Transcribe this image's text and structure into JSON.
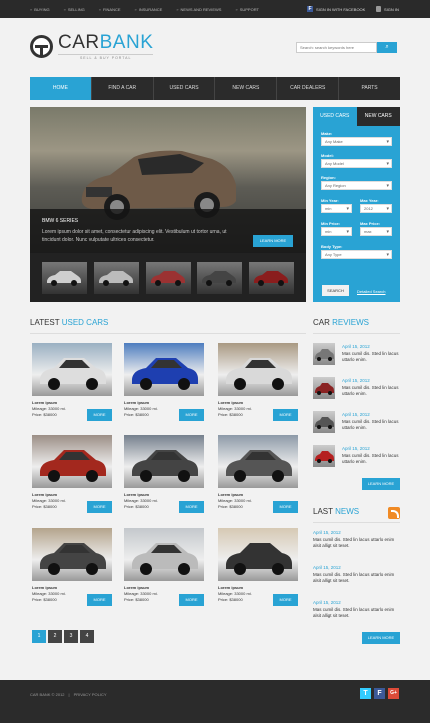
{
  "topbar": {
    "links": [
      "Buying",
      "Selling",
      "Finance",
      "Insurance",
      "News and reviews",
      "Support"
    ],
    "facebook": "Sign in with Facebook",
    "signin": "Sign in"
  },
  "logo": {
    "title_a": "CAR",
    "title_b": "BANK",
    "subtitle": "Sell & buy portal"
  },
  "search": {
    "placeholder": "Search: search keywords here"
  },
  "nav": [
    "Home",
    "Find a car",
    "Used cars",
    "New cars",
    "Car dealers",
    "Parts"
  ],
  "hero": {
    "title": "BMW 6 Series",
    "description": "Lorem ipsum dolor sit amet, consectetur adipiscing elit. Vestibulum ut tortor urna, ut tincidunt dolor. Nunc vulputate ultrices consectetur.",
    "button": "Learn more"
  },
  "finder": {
    "tabs": [
      "Used cars",
      "New cars"
    ],
    "make_label": "Make:",
    "make_value": "Any Make",
    "model_label": "Model:",
    "model_value": "Any Model",
    "region_label": "Region:",
    "region_value": "Any Region",
    "minyear_label": "Min Year:",
    "minyear_value": "min",
    "maxyear_label": "Max Year:",
    "maxyear_value": "2012",
    "minprice_label": "Min Price:",
    "minprice_value": "min",
    "maxprice_label": "Max Price:",
    "maxprice_value": "max",
    "bodytype_label": "Body Type:",
    "bodytype_value": "Any Type",
    "search_button": "Search",
    "detailed": "Detailed Search"
  },
  "latest": {
    "title_a": "Latest ",
    "title_b": "Used Cars"
  },
  "cars": [
    {
      "name": "Lorem ipsum",
      "mileage": "Mileage: 33000 mi.",
      "price": "Price: $38000"
    },
    {
      "name": "Lorem ipsum",
      "mileage": "Mileage: 33000 mi.",
      "price": "Price: $38000"
    },
    {
      "name": "Lorem ipsum",
      "mileage": "Mileage: 33000 mi.",
      "price": "Price: $38000"
    },
    {
      "name": "Lorem ipsum",
      "mileage": "Mileage: 33000 mi.",
      "price": "Price: $38000"
    },
    {
      "name": "Lorem ipsum",
      "mileage": "Mileage: 33000 mi.",
      "price": "Price: $38000"
    },
    {
      "name": "Lorem ipsum",
      "mileage": "Mileage: 33000 mi.",
      "price": "Price: $38000"
    },
    {
      "name": "Lorem ipsum",
      "mileage": "Mileage: 33000 mi.",
      "price": "Price: $38000"
    },
    {
      "name": "Lorem ipsum",
      "mileage": "Mileage: 33000 mi.",
      "price": "Price: $38000"
    },
    {
      "name": "Lorem ipsum",
      "mileage": "Mileage: 33000 mi.",
      "price": "Price: $38000"
    }
  ],
  "more_label": "More",
  "pages": [
    "1",
    "2",
    "3",
    "4"
  ],
  "reviews": {
    "title_a": "Car ",
    "title_b": "Reviews",
    "items": [
      {
        "date": "April 15, 2012",
        "text": "Mas cumil dis. Sted lin lacus uttarlo enim."
      },
      {
        "date": "April 15, 2012",
        "text": "Mas cumil dis. Sted lin lacus uttarlo enim."
      },
      {
        "date": "April 15, 2012",
        "text": "Mas cumil dis. Sted lin lacus uttarlo enim."
      },
      {
        "date": "April 15, 2012",
        "text": "Mas cumil dis. Sted lin lacus uttarlo enim."
      }
    ],
    "button": "Learn more"
  },
  "news": {
    "title_a": "Last ",
    "title_b": "News",
    "items": [
      {
        "date": "April 15, 2012",
        "text": "Mas cumil dis. Sted lin lacus uttarlo enim alsit alligt sit teset."
      },
      {
        "date": "April 15, 2012",
        "text": "Mas cumil dis. Sted lin lacus uttarlo enim alsit alligt sit teset."
      },
      {
        "date": "April 15, 2012",
        "text": "Mas cumil dis. Sted lin lacus uttarlo enim alsit alligt sit teset."
      }
    ],
    "button": "Learn more"
  },
  "footer": {
    "copyright": "Car Bank © 2012",
    "privacy": "Privacy Policy"
  },
  "colors": {
    "accent": "#29a3d4",
    "dark": "#2b2b2b"
  }
}
